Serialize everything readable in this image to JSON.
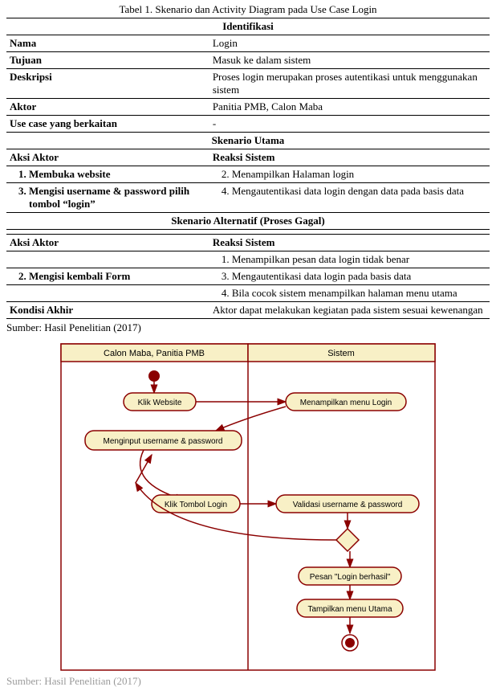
{
  "caption": "Tabel 1. Skenario dan Activity Diagram pada Use Case Login",
  "sections": {
    "ident_head": "Identifikasi",
    "nama_k": "Nama",
    "nama_v": "Login",
    "tujuan_k": "Tujuan",
    "tujuan_v": "Masuk ke  dalam sistem",
    "deskripsi_k": "Deskripsi",
    "deskripsi_v": "Proses login merupakan proses autentikasi untuk menggunakan sistem",
    "aktor_k": "Aktor",
    "aktor_v": "Panitia PMB, Calon Maba",
    "usecase_k": "Use case yang berkaitan",
    "usecase_v": "-",
    "utama_head": "Skenario Utama",
    "aksi_aktor": "Aksi Aktor",
    "reaksi_sistem": "Reaksi Sistem",
    "u_a1": "Membuka website",
    "u_r1": "Menampilkan Halaman login",
    "u_a2": "Mengisi username & password pilih tombol “login”",
    "u_r2": "Mengautentikasi data login dengan data pada basis data",
    "alt_head": "Skenario Alternatif (Proses Gagal)",
    "alt_r1": "Menampilkan pesan data login tidak benar",
    "alt_a2": "Mengisi kembali Form",
    "alt_r2": "Mengautentikasi data login pada basis data",
    "alt_r3": "Bila cocok sistem menampilkan halaman menu utama",
    "kondisi_k": "Kondisi Akhir",
    "kondisi_v": "Aktor dapat melakukan kegiatan pada sistem sesuai kewenangan"
  },
  "source1": "Sumber: Hasil Penelitian (2017)",
  "diagram": {
    "lane1": "Calon Maba, Panitia PMB",
    "lane2": "Sistem",
    "n1": "Klik Website",
    "n2": "Menampilkan menu Login",
    "n3": "Menginput username & password",
    "n4": "Klik Tombol Login",
    "n5": "Validasi username & password",
    "n6": "Pesan \"Login berhasil\"",
    "n7": "Tampilkan menu Utama"
  },
  "source2": "Sumber: Hasil Penelitian (2017)"
}
